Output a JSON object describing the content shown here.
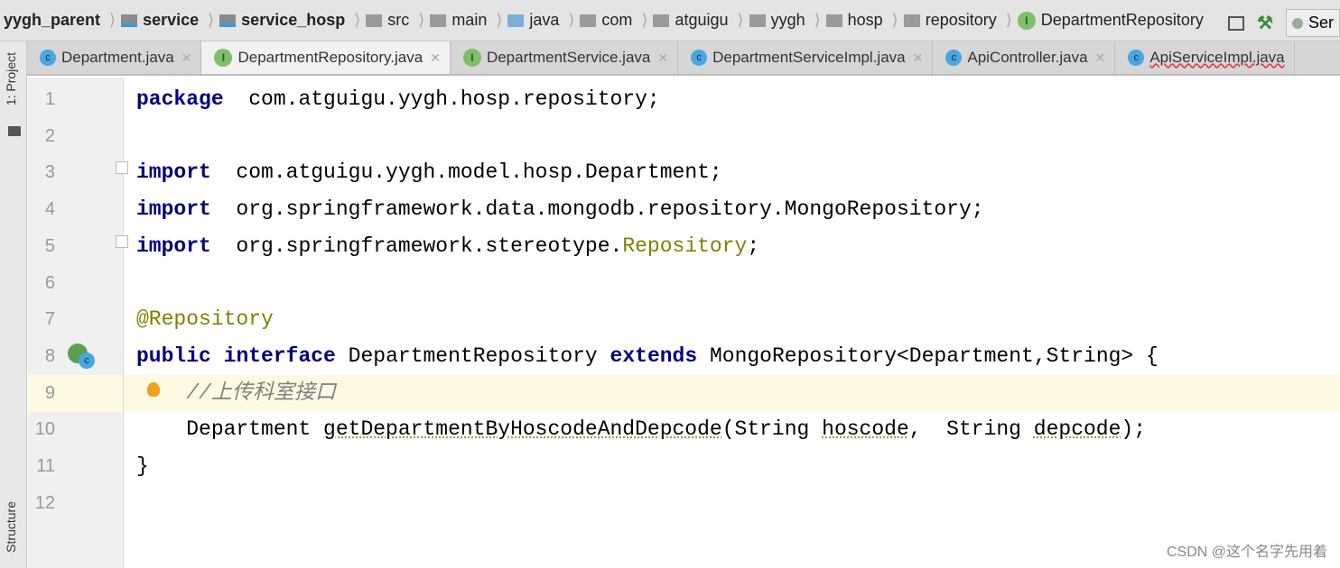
{
  "breadcrumb": [
    {
      "label": "yygh_parent",
      "icon": "module-folder-icon",
      "bold": true
    },
    {
      "label": "service",
      "icon": "module-folder-icon",
      "bold": true
    },
    {
      "label": "service_hosp",
      "icon": "module-folder-icon",
      "bold": true
    },
    {
      "label": "src",
      "icon": "folder-icon"
    },
    {
      "label": "main",
      "icon": "folder-icon"
    },
    {
      "label": "java",
      "icon": "source-folder-icon"
    },
    {
      "label": "com",
      "icon": "package-icon"
    },
    {
      "label": "atguigu",
      "icon": "package-icon"
    },
    {
      "label": "yygh",
      "icon": "package-icon"
    },
    {
      "label": "hosp",
      "icon": "package-icon"
    },
    {
      "label": "repository",
      "icon": "package-icon"
    },
    {
      "label": "DepartmentRepository",
      "icon": "interface-icon"
    }
  ],
  "toolbar": {
    "run_config_label": "Ser"
  },
  "tabs": [
    {
      "label": "Department.java",
      "type": "class"
    },
    {
      "label": "DepartmentRepository.java",
      "type": "interface",
      "active": true
    },
    {
      "label": "DepartmentService.java",
      "type": "interface"
    },
    {
      "label": "DepartmentServiceImpl.java",
      "type": "class"
    },
    {
      "label": "ApiController.java",
      "type": "class"
    },
    {
      "label": "ApiServiceImpl.java",
      "type": "class",
      "error": true
    }
  ],
  "side_panels": {
    "project": "1: Project",
    "structure": "Structure"
  },
  "current_line": 9,
  "code_lines": [
    [
      [
        "kw",
        "package"
      ],
      [
        "",
        "  com.atguigu.yygh.hosp.repository;"
      ]
    ],
    [],
    [
      [
        "kw",
        "import"
      ],
      [
        "",
        "  com.atguigu.yygh.model.hosp.Department;"
      ]
    ],
    [
      [
        "kw",
        "import"
      ],
      [
        "",
        "  org.springframework.data.mongodb.repository.MongoRepository;"
      ]
    ],
    [
      [
        "kw",
        "import"
      ],
      [
        "",
        "  org.springframework.stereotype."
      ],
      [
        "unused",
        "Repository"
      ],
      [
        "",
        ";"
      ]
    ],
    [],
    [
      [
        "ann",
        "@Repository"
      ]
    ],
    [
      [
        "kw",
        "public"
      ],
      [
        "",
        " "
      ],
      [
        "kw",
        "interface"
      ],
      [
        "",
        " DepartmentRepository "
      ],
      [
        "kw",
        "extends"
      ],
      [
        "",
        " MongoRepository<Department,String> {"
      ]
    ],
    [
      [
        "",
        "    "
      ],
      [
        "cm",
        "//上传科室接口"
      ]
    ],
    [
      [
        "",
        "    Department "
      ],
      [
        "warn",
        "getDepartmentByHoscodeAndDepcode"
      ],
      [
        "",
        "(String "
      ],
      [
        "warn",
        "hoscode"
      ],
      [
        "",
        ",  String "
      ],
      [
        "warn",
        "depcode"
      ],
      [
        "",
        ");"
      ]
    ],
    [
      [
        "",
        "}"
      ]
    ],
    []
  ],
  "watermark": "CSDN @这个名字先用着"
}
